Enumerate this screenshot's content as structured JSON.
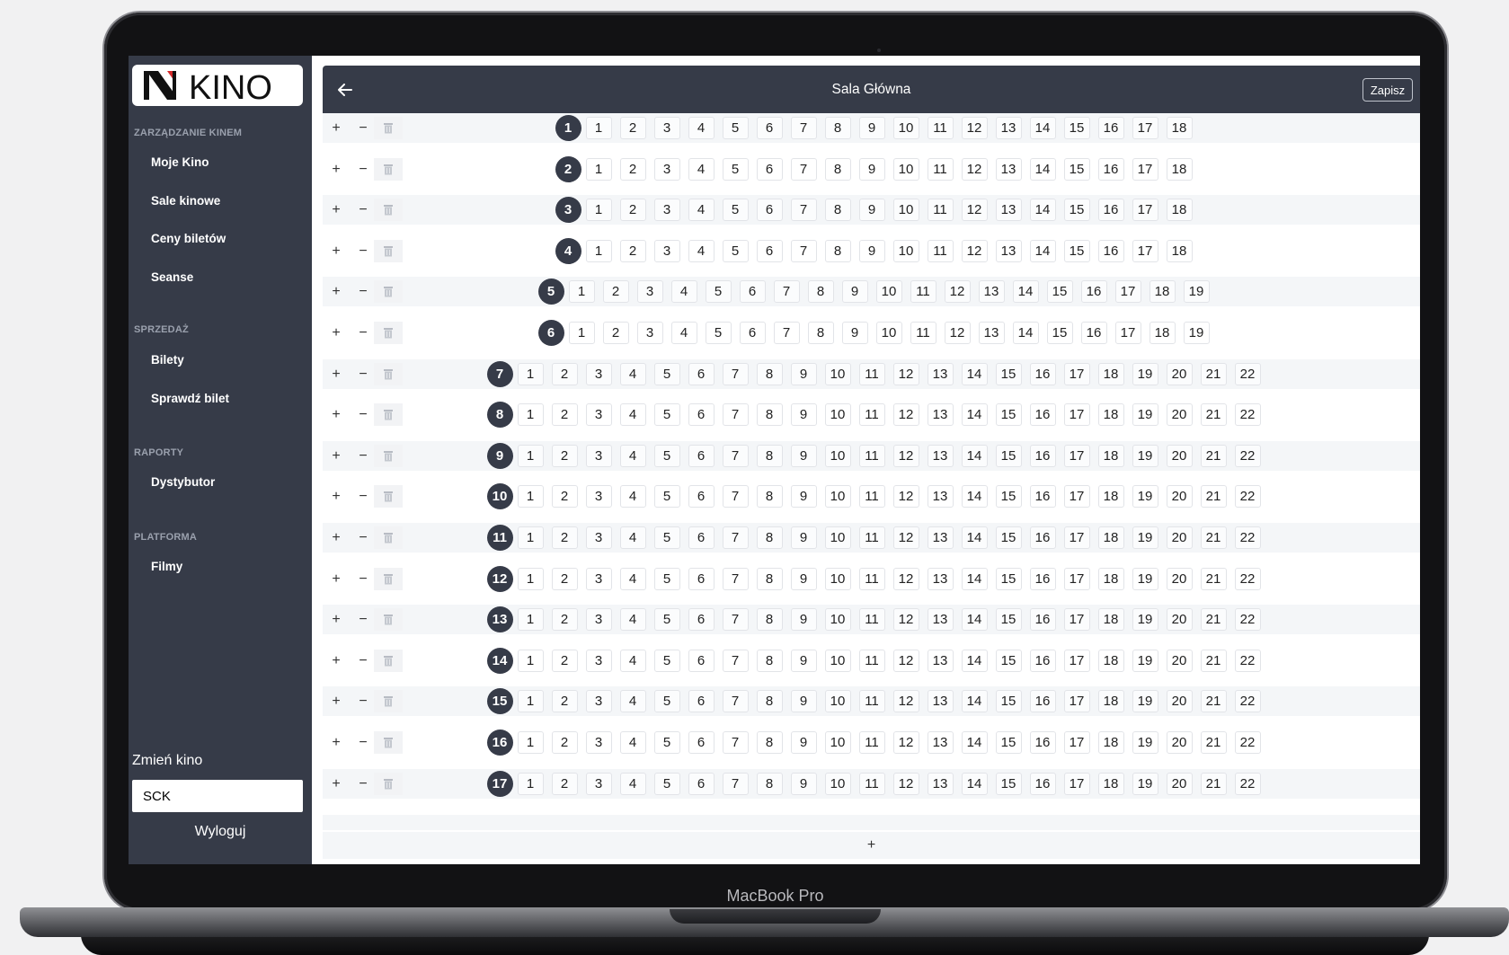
{
  "device_label": "MacBook Pro",
  "brand": {
    "name": "KINO"
  },
  "sidebar": {
    "sections": [
      {
        "heading": "ZARZĄDZANIE KINEM",
        "items": [
          "Moje Kino",
          "Sale kinowe",
          "Ceny biletów",
          "Seanse"
        ]
      },
      {
        "heading": "SPRZEDAŻ",
        "items": [
          "Bilety",
          "Sprawdź bilet"
        ]
      },
      {
        "heading": "RAPORTY",
        "items": [
          "Dystybutor"
        ]
      },
      {
        "heading": "PLATFORMA",
        "items": [
          "Filmy"
        ]
      }
    ],
    "change_cinema_label": "Zmień kino",
    "cinema_value": "SCK",
    "logout_label": "Wyloguj"
  },
  "header": {
    "title": "Sala Główna",
    "save_label": "Zapisz",
    "back_icon": "arrow-left-icon"
  },
  "row_controls": {
    "add": "+",
    "remove": "−",
    "delete_icon": "trash-icon"
  },
  "add_row_label": "+",
  "rows": [
    {
      "number": "1",
      "seats": 18
    },
    {
      "number": "2",
      "seats": 18
    },
    {
      "number": "3",
      "seats": 18
    },
    {
      "number": "4",
      "seats": 18
    },
    {
      "number": "5",
      "seats": 19
    },
    {
      "number": "6",
      "seats": 19
    },
    {
      "number": "7",
      "seats": 22
    },
    {
      "number": "8",
      "seats": 22
    },
    {
      "number": "9",
      "seats": 22
    },
    {
      "number": "10",
      "seats": 22
    },
    {
      "number": "11",
      "seats": 22
    },
    {
      "number": "12",
      "seats": 22
    },
    {
      "number": "13",
      "seats": 22
    },
    {
      "number": "14",
      "seats": 22
    },
    {
      "number": "15",
      "seats": 22
    },
    {
      "number": "16",
      "seats": 22
    },
    {
      "number": "17",
      "seats": 22
    }
  ],
  "colors": {
    "sidebar": "#363b48",
    "topbar": "#363b48",
    "badge": "#363b48"
  }
}
